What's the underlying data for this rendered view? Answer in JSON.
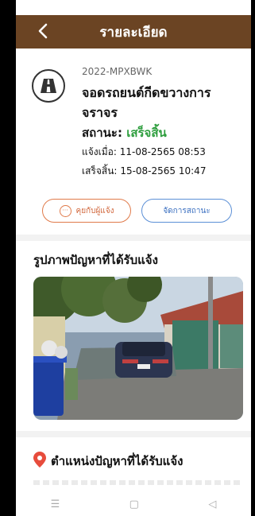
{
  "header": {
    "title": "รายละเอียด",
    "back_icon": "chevron-left-icon"
  },
  "report": {
    "code": "2022-MPXBWK",
    "title": "จอดรถยนต์กีดขวางการจราจร",
    "status_label": "สถานะ:",
    "status_value": "เสร็จสิ้น",
    "reported_label": "แจ้งเมื่อ:",
    "reported_at": "11-08-2565 08:53",
    "finished_label": "เสร็จสิ้น:",
    "finished_at": "15-08-2565 10:47",
    "icon": "road-icon"
  },
  "actions": {
    "chat_label": "คุยกับผู้แจ้ง",
    "manage_label": "จัดการสถานะ"
  },
  "sections": {
    "photo_title": "รูปภาพปัญหาที่ได้รับแจ้ง",
    "location_title": "ตำแหน่งปัญหาที่ได้รับแจ้ง"
  },
  "nav": {
    "menu": "☰",
    "home": "▢",
    "back": "◁"
  },
  "colors": {
    "header": "#6b4423",
    "status": "#2e9e3e",
    "chat": "#e07a4a",
    "manage": "#5b8fd6",
    "pin": "#e74c3c"
  }
}
